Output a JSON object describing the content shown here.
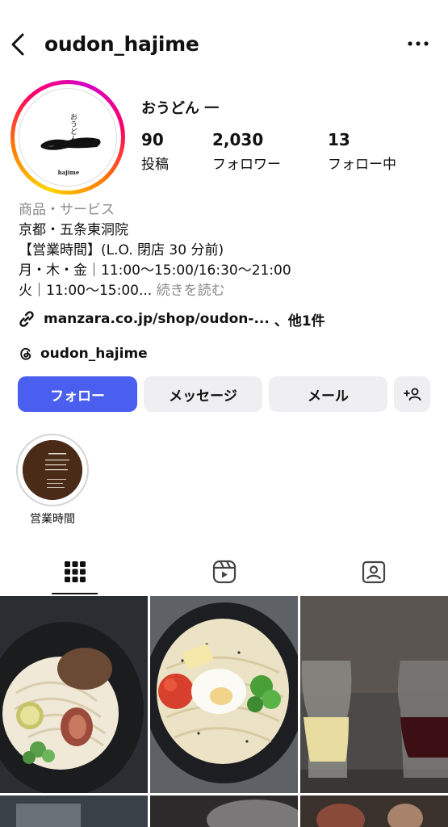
{
  "header": {
    "username": "oudon_hajime",
    "back_icon": "chevron-left-icon",
    "more_icon": "more-dots-icon"
  },
  "profile": {
    "display_name": "おうどん 一",
    "avatar_text": "おうどん",
    "avatar_brand": "hajime",
    "stats": [
      {
        "value": "90",
        "label": "投稿"
      },
      {
        "value": "2,030",
        "label": "フォロワー"
      },
      {
        "value": "13",
        "label": "フォロー中"
      }
    ]
  },
  "bio": {
    "category": "商品・サービス",
    "lines": [
      "京都・五条東洞院",
      "【営業時間】(L.O. 閉店 30 分前)",
      "月・木・金｜11:00〜15:00/16:30〜21:00"
    ],
    "truncated_line": "火｜11:00〜15:00...",
    "more_label": "続きを読む"
  },
  "link": {
    "text": "manzara.co.jp/shop/oudon-...",
    "extra": "、他1件"
  },
  "threads": {
    "handle": "oudon_hajime"
  },
  "buttons": {
    "follow": "フォロー",
    "message": "メッセージ",
    "mail": "メール"
  },
  "highlight": {
    "label": "営業時間"
  },
  "colors": {
    "primary": "#4a5ff0",
    "secondary_button": "#efeff1",
    "muted_text": "#8a8a8a"
  }
}
